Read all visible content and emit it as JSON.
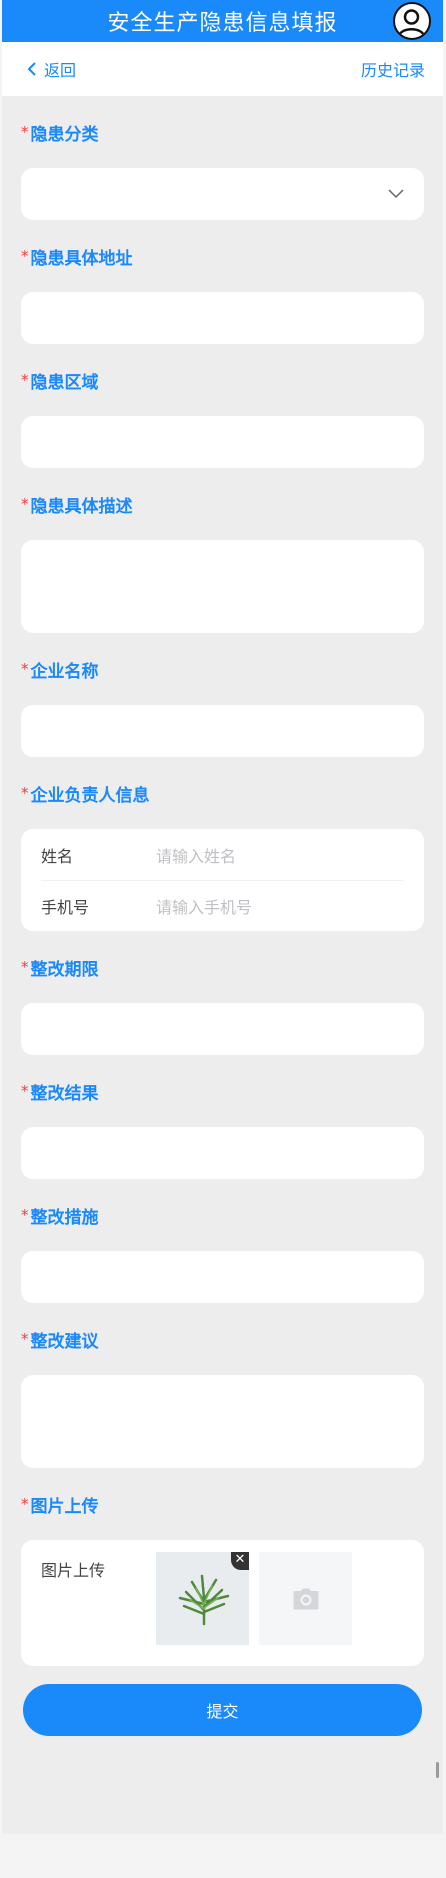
{
  "header": {
    "title": "安全生产隐患信息填报",
    "avatar_icon": "user-circle-icon",
    "bar_color": "#1a89fa"
  },
  "nav": {
    "back_label": "返回",
    "history_label": "历史记录"
  },
  "form": {
    "required_mark": "*",
    "fields": {
      "category": {
        "label": "隐患分类",
        "value": ""
      },
      "address": {
        "label": "隐患具体地址",
        "value": ""
      },
      "area": {
        "label": "隐患区域",
        "value": ""
      },
      "description": {
        "label": "隐患具体描述",
        "value": ""
      },
      "company": {
        "label": "企业名称",
        "value": ""
      },
      "contact": {
        "label": "企业负责人信息",
        "name_label": "姓名",
        "name_placeholder": "请输入姓名",
        "phone_label": "手机号",
        "phone_placeholder": "请输入手机号"
      },
      "deadline": {
        "label": "整改期限",
        "value": ""
      },
      "result": {
        "label": "整改结果",
        "value": ""
      },
      "measures": {
        "label": "整改措施",
        "value": ""
      },
      "suggestion": {
        "label": "整改建议",
        "value": ""
      },
      "images": {
        "label": "图片上传",
        "inner_label": "图片上传",
        "delete_glyph": "✕",
        "uploaded_count": 1
      }
    },
    "submit_label": "提交"
  }
}
